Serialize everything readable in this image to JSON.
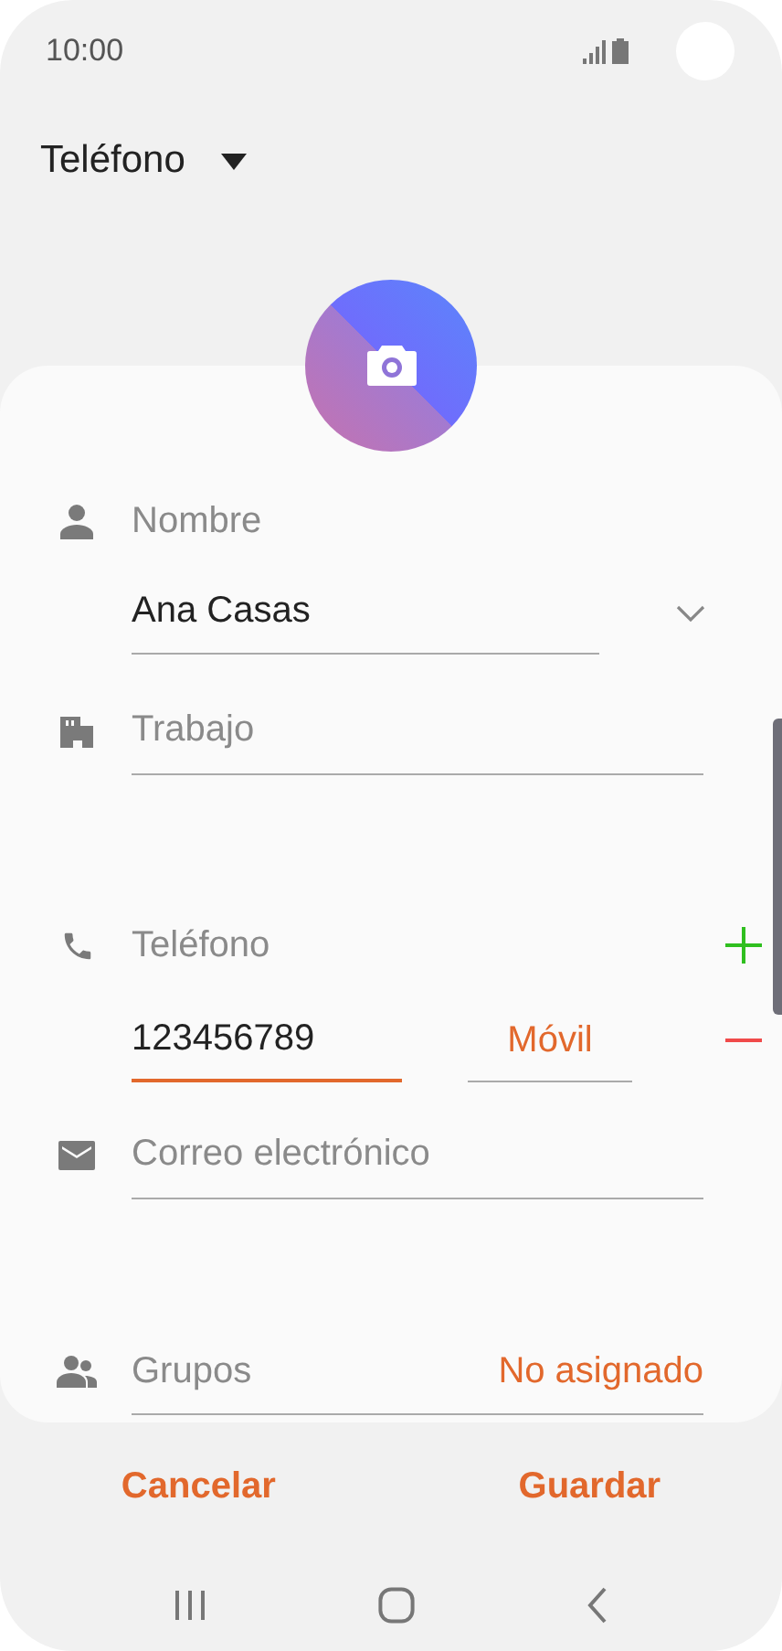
{
  "status_bar": {
    "time": "10:00"
  },
  "account": {
    "label": "Teléfono"
  },
  "sections": [
    {
      "kind": "name",
      "label": "Nombre",
      "value": "Ana Casas"
    },
    {
      "kind": "work",
      "placeholder": "Trabajo"
    },
    {
      "kind": "phone",
      "label": "Teléfono",
      "value": "123456789",
      "focused": true,
      "type": "Móvil"
    },
    {
      "kind": "email",
      "placeholder": "Correo electrónico"
    },
    {
      "kind": "groups",
      "label": "Grupos",
      "value": "No asignado"
    }
  ],
  "buttons": [
    "Cancelar",
    "Guardar"
  ]
}
